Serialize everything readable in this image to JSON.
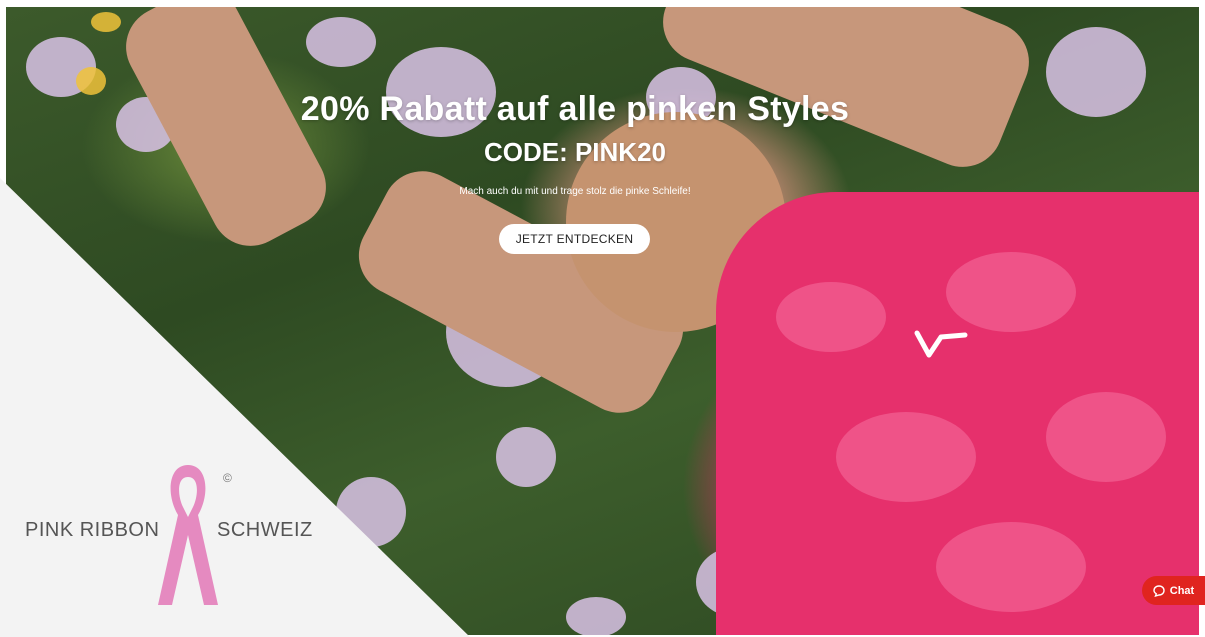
{
  "hero": {
    "headline": "20% Rabatt auf alle pinken Styles",
    "code": "CODE: PINK20",
    "subtext": "Mach auch du mit und trage stolz die pinke Schleife!",
    "cta_label": "JETZT ENTDECKEN"
  },
  "badge": {
    "left_text": "PINK RIBBON",
    "right_text": "SCHWEIZ",
    "copyright": "©"
  },
  "chat": {
    "label": "Chat",
    "icon": "chat-bubble-icon"
  },
  "colors": {
    "accent": "#e6306c",
    "chat": "#e0241f",
    "ribbon": "#e58ac0"
  }
}
